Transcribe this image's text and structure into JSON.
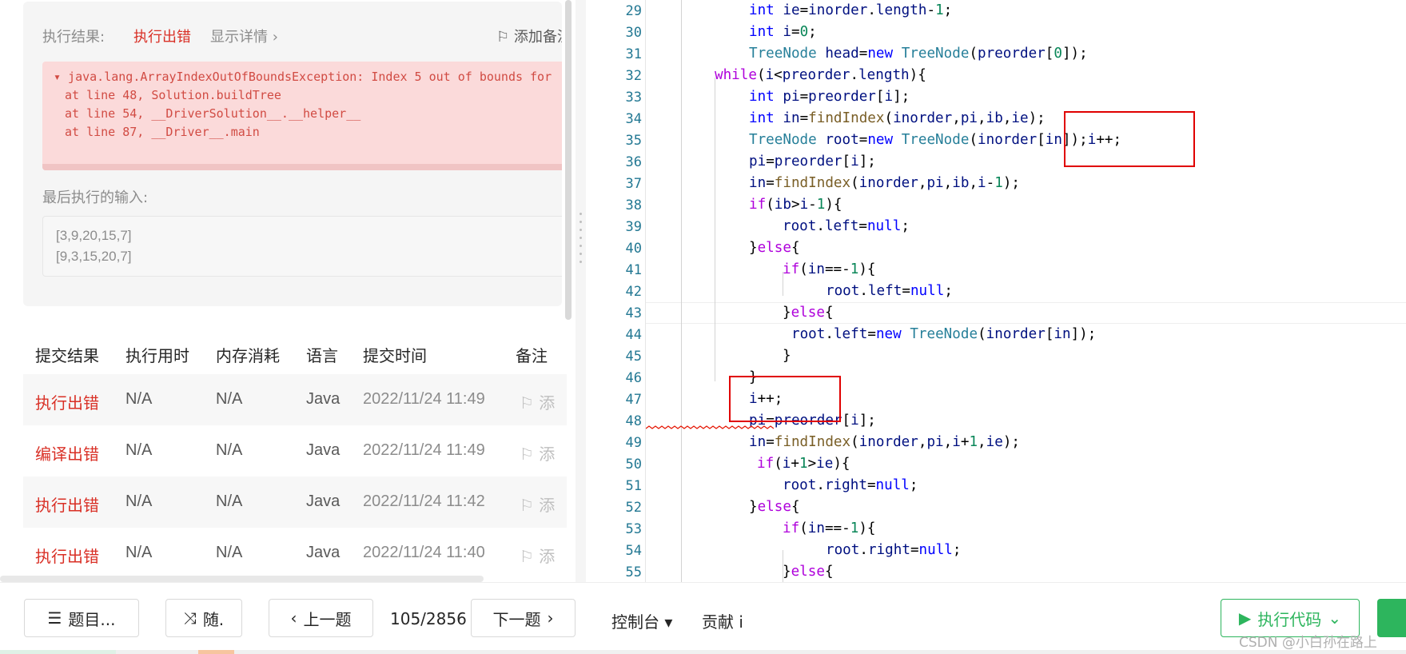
{
  "result": {
    "label": "执行结果:",
    "status": "执行出错",
    "details": "显示详情 ›",
    "add_note": "⚐ 添加备注",
    "error_lines": [
      "▾ java.lang.ArrayIndexOutOfBoundsException: Index 5 out of bounds for",
      "  at line 48, Solution.buildTree",
      "  at line 54, __DriverSolution__.__helper__",
      "  at line 87, __Driver__.main"
    ],
    "last_input_label": "最后执行的输入:",
    "inputs": [
      "[3,9,20,15,7]",
      "[9,3,15,20,7]"
    ]
  },
  "submissions": {
    "headers": [
      "提交结果",
      "执行用时",
      "内存消耗",
      "语言",
      "提交时间",
      "备注"
    ],
    "rows": [
      {
        "status": "执行出错",
        "time": "N/A",
        "memory": "N/A",
        "lang": "Java",
        "date": "2022/11/24 11:49",
        "note": "⚐ 添"
      },
      {
        "status": "编译出错",
        "time": "N/A",
        "memory": "N/A",
        "lang": "Java",
        "date": "2022/11/24 11:49",
        "note": "⚐ 添"
      },
      {
        "status": "执行出错",
        "time": "N/A",
        "memory": "N/A",
        "lang": "Java",
        "date": "2022/11/24 11:42",
        "note": "⚐ 添"
      },
      {
        "status": "执行出错",
        "time": "N/A",
        "memory": "N/A",
        "lang": "Java",
        "date": "2022/11/24 11:40",
        "note": "⚐ 添"
      }
    ]
  },
  "editor": {
    "line_numbers": [
      "29",
      "30",
      "31",
      "32",
      "33",
      "34",
      "35",
      "36",
      "37",
      "38",
      "39",
      "40",
      "41",
      "42",
      "43",
      "44",
      "45",
      "46",
      "47",
      "48",
      "49",
      "50",
      "51",
      "52",
      "53",
      "54",
      "55"
    ]
  },
  "bottom": {
    "problems": "题目...",
    "random": "随.",
    "prev": "上一题",
    "counter": "105/2856",
    "next": "下一题",
    "console": "控制台 ▾",
    "contribute": "贡献 i",
    "run": "执行代码",
    "watermark": "CSDN @小白孙在路上"
  },
  "colors": {
    "error_red": "#d93026",
    "accent_green": "#2db55d",
    "highlight_box": "#e00000"
  }
}
